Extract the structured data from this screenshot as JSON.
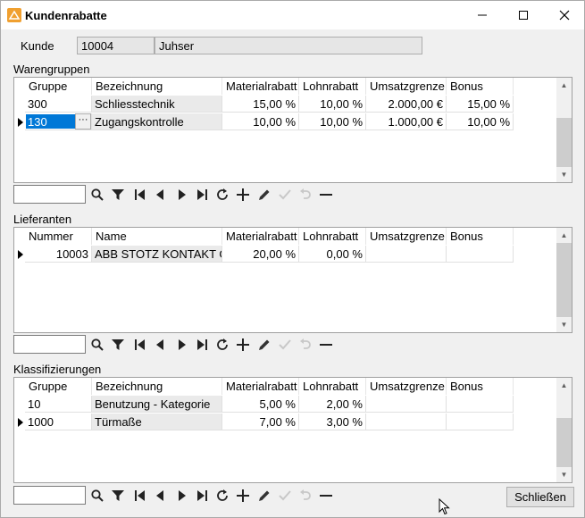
{
  "window": {
    "title": "Kundenrabatte"
  },
  "customer": {
    "label": "Kunde",
    "number": "10004",
    "name": "Juhser"
  },
  "warengruppen": {
    "label": "Warengruppen",
    "headers": [
      "Gruppe",
      "Bezeichnung",
      "Materialrabatt",
      "Lohnrabatt",
      "Umsatzgrenze",
      "Bonus"
    ],
    "rows": [
      [
        "300",
        "Schliesstechnik",
        "15,00 %",
        "10,00 %",
        "2.000,00 €",
        "15,00 %"
      ],
      [
        "130",
        "Zugangskontrolle",
        "10,00 %",
        "10,00 %",
        "1.000,00 €",
        "10,00 %"
      ]
    ],
    "ellipsis": "···"
  },
  "lieferanten": {
    "label": "Lieferanten",
    "headers": [
      "Nummer",
      "Name",
      "Materialrabatt",
      "Lohnrabatt",
      "Umsatzgrenze",
      "Bonus"
    ],
    "rows": [
      [
        "10003",
        "ABB STOTZ KONTAKT G",
        "20,00 %",
        "0,00 %",
        "",
        ""
      ]
    ]
  },
  "klassifizierungen": {
    "label": "Klassifizierungen",
    "headers": [
      "Gruppe",
      "Bezeichnung",
      "Materialrabatt",
      "Lohnrabatt",
      "Umsatzgrenze",
      "Bonus"
    ],
    "rows": [
      [
        "10",
        "Benutzung - Kategorie",
        "5,00 %",
        "2,00 %",
        "",
        ""
      ],
      [
        "1000",
        "Türmaße",
        "7,00 %",
        "3,00 %",
        "",
        ""
      ]
    ]
  },
  "toolbar_icons": [
    "search-icon",
    "filter-icon",
    "first-icon",
    "prev-icon",
    "next-icon",
    "last-icon",
    "refresh-icon",
    "add-icon",
    "edit-icon",
    "confirm-icon",
    "undo-icon",
    "delete-icon"
  ],
  "buttons": {
    "close": "Schließen"
  },
  "colors": {
    "selection": "#0078d7",
    "background": "#f0f0f0"
  }
}
